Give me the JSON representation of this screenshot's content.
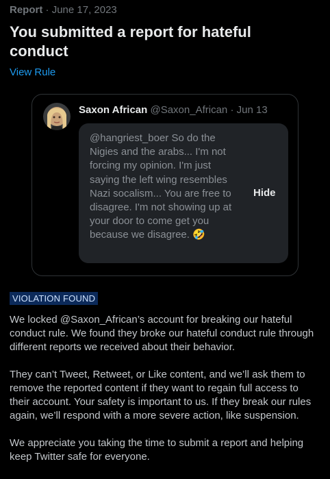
{
  "header": {
    "report_label": "Report",
    "separator": "·",
    "date": "June 17, 2023",
    "title": "You submitted a report for hateful conduct",
    "view_rule": "View Rule"
  },
  "tweet": {
    "name": "Saxon African",
    "handle": "@Saxon_African",
    "separator": "·",
    "date": "Jun 13",
    "text": "@hangriest_boer So do the Nigies and the arabs... I'm not forcing my opinion. I'm just saying the left wing resembles Nazi socalism... You are free to disagree. I'm not showing up at your door to come get you because we disagree. 🤣",
    "hide_label": "Hide"
  },
  "violation": {
    "badge": "VIOLATION FOUND",
    "paragraphs": [
      "We locked @Saxon_African’s account for breaking our hateful conduct rule. We found they broke our hateful conduct rule through different reports we received about their behavior.",
      "They can’t Tweet, Retweet, or Like content, and we’ll ask them to remove the reported content if they want to regain full access to their account. Your safety is important to us. If they break our rules again, we’ll respond with a more severe action, like suspension.",
      "We appreciate you taking the time to submit a report and helping keep Twitter safe for everyone."
    ]
  },
  "colors": {
    "background": "#000000",
    "link": "#1d9bf0",
    "badge_bg": "#0c2a5a",
    "card_border": "#2f3336"
  }
}
